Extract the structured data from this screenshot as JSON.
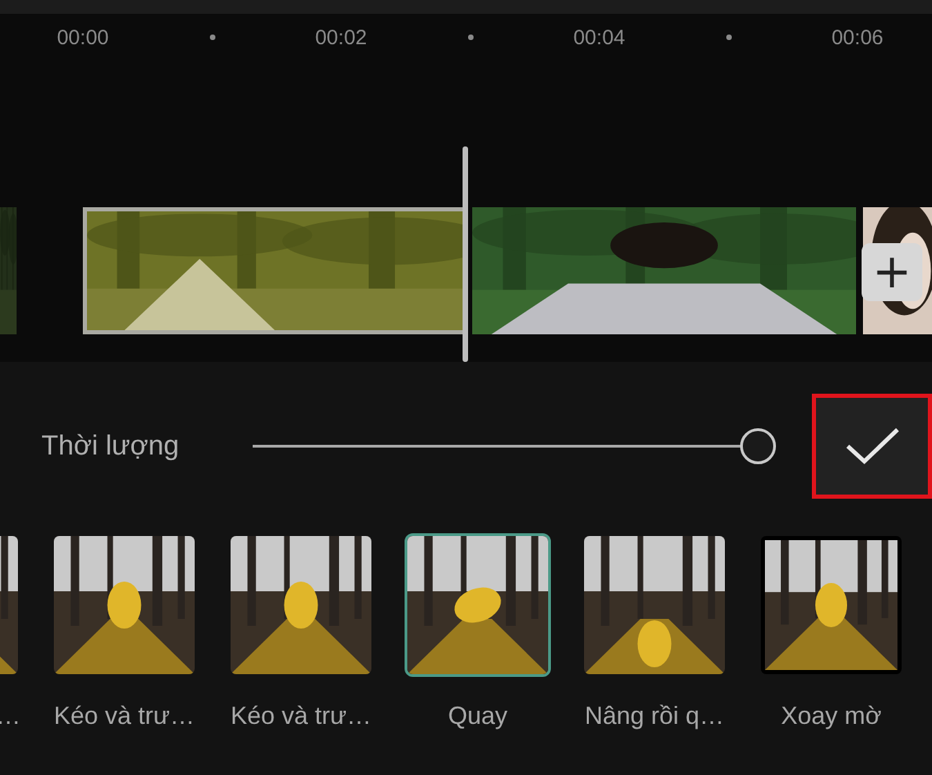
{
  "ruler": {
    "ticks": [
      "00:00",
      "00:02",
      "00:04",
      "00:06"
    ]
  },
  "timeline": {
    "clips": [
      {
        "kind": "picture",
        "selected": false
      },
      {
        "kind": "picture",
        "selected": true
      },
      {
        "kind": "picture",
        "selected": false
      },
      {
        "kind": "picture",
        "selected": false
      }
    ],
    "add_button": {
      "label": "+"
    }
  },
  "duration": {
    "label": "Thời lượng",
    "level": 1.0
  },
  "confirm_button": {
    "highlighted": true
  },
  "effects": [
    {
      "label": "…",
      "selected": false,
      "partial": true
    },
    {
      "label": "Kéo và trư…",
      "selected": false
    },
    {
      "label": "Kéo và trư…",
      "selected": false
    },
    {
      "label": "Quay",
      "selected": true
    },
    {
      "label": "Nâng rồi q…",
      "selected": false
    },
    {
      "label": "Xoay mờ",
      "selected": false
    }
  ]
}
